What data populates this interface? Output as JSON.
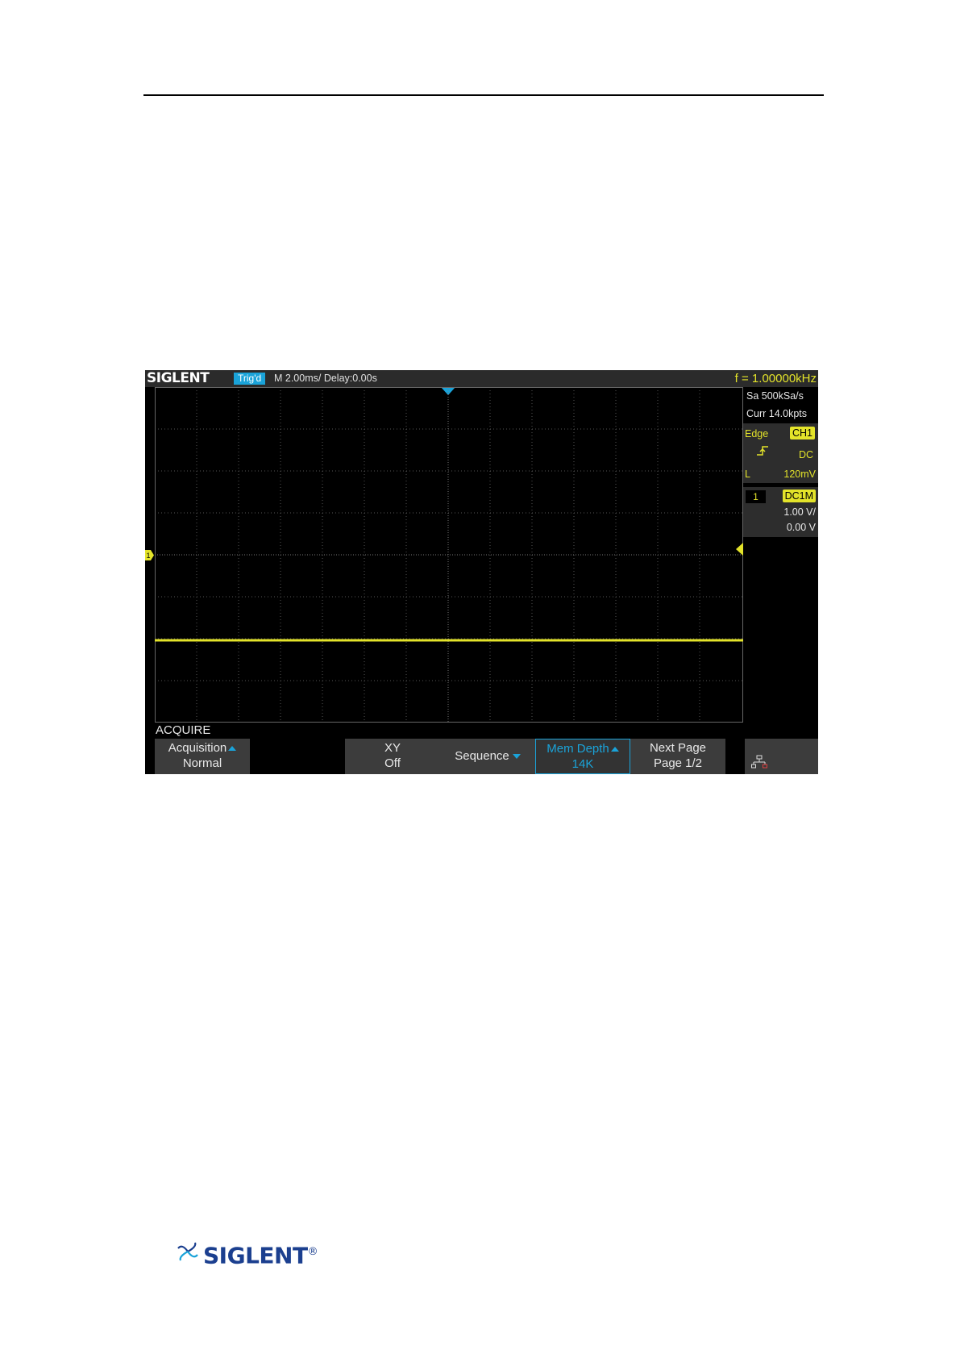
{
  "status_bar": {
    "brand": "SIGLENT",
    "trigger_status": "Trig'd",
    "timebase": "M 2.00ms/ Delay:0.00s",
    "frequency": "f = 1.00000kHz"
  },
  "acquisition_info": {
    "sample_rate": "Sa 500kSa/s",
    "current_depth": "Curr 14.0kpts"
  },
  "trigger": {
    "type": "Edge",
    "source": "CH1",
    "coupling": "DC",
    "level_label": "L",
    "level": "120mV"
  },
  "channel1": {
    "number": "1",
    "coupling": "DC1M",
    "scale": "1.00 V/",
    "offset": "0.00 V",
    "marker": "1"
  },
  "menu": {
    "title": "ACQUIRE",
    "acquisition": {
      "label": "Acquisition",
      "value": "Normal"
    },
    "xy": {
      "label": "XY",
      "value": "Off"
    },
    "sequence": {
      "label": "Sequence"
    },
    "mem_depth": {
      "label": "Mem Depth",
      "value": "14K"
    },
    "next_page": {
      "label": "Next Page",
      "value": "Page 1/2"
    }
  },
  "footer": {
    "brand": "SIGLENT",
    "registered": "®"
  },
  "colors": {
    "trace": "#e3e32a",
    "accent": "#1aa3d9",
    "footer_brand": "#1b3f8f"
  }
}
